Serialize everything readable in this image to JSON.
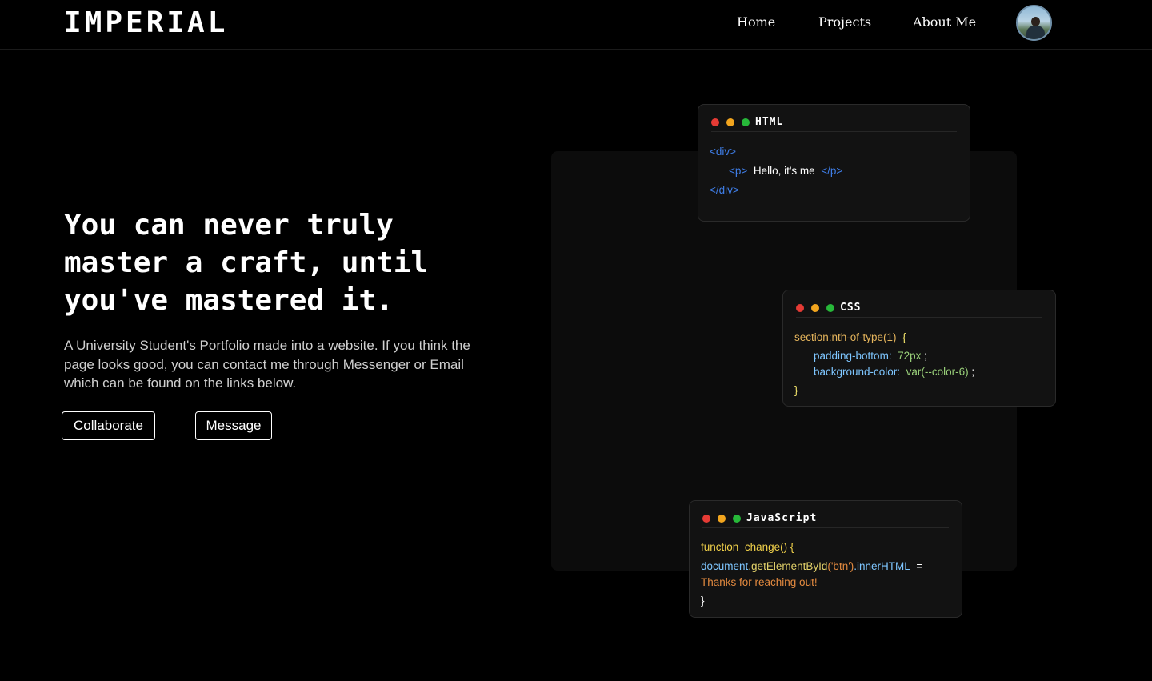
{
  "nav": {
    "logo": "IMPERIAL",
    "links": [
      "Home",
      "Projects",
      "About Me"
    ],
    "avatar": "profile-avatar"
  },
  "hero": {
    "headline": "You can never truly master a craft, until you've mastered it.",
    "subtext": "A University Student's Portfolio made into a website. If you think the page looks good, you can contact me through Messenger or Email which can be found on the links below.",
    "buttons": {
      "collaborate": "Collaborate",
      "message": "Message"
    }
  },
  "cards": {
    "html": {
      "title": "HTML",
      "div_open": "div",
      "p_open": "p",
      "p_text": "Hello, it's me",
      "p_close": "p",
      "div_close": "div"
    },
    "css": {
      "title": "CSS",
      "selector": "section:nth-of-type(1)",
      "open_brace": "{",
      "prop1": "padding-bottom:",
      "val1": "72px",
      "prop2": "background-color:",
      "val2": "var(--color-6)",
      "close_brace": "}"
    },
    "js": {
      "title": "JavaScript",
      "keyword": "function",
      "fn_name": "change() {",
      "object": "document",
      "method": ".getElementById",
      "arg": "'btn'",
      "prop": ".innerHTML",
      "assign": "=",
      "string": "Thanks for reaching out!",
      "close_brace": "}"
    }
  },
  "colors": {
    "background": "#000000",
    "card": "#121212",
    "dot_red": "#e53b35",
    "dot_yellow": "#f2a51e",
    "dot_green": "#27b839",
    "tag_blue": "#3f7ee8"
  }
}
